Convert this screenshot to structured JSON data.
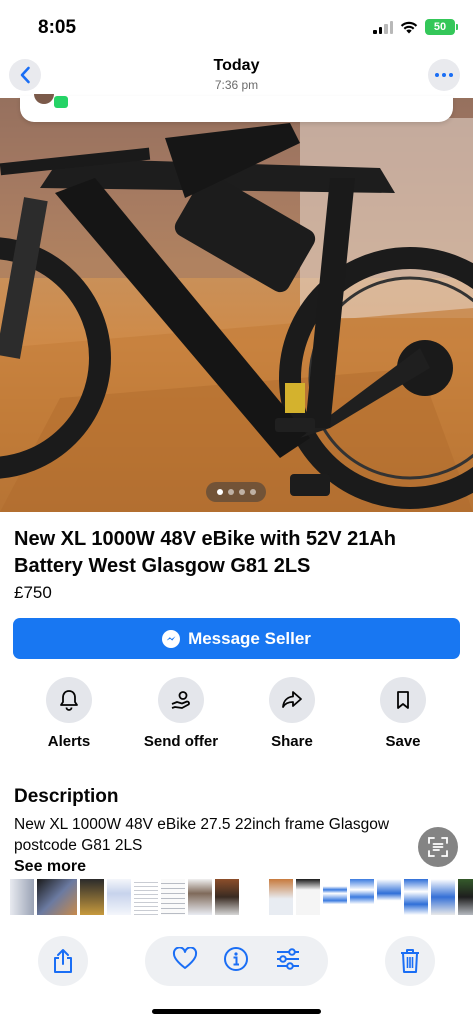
{
  "status_bar": {
    "time": "8:05",
    "battery": "50"
  },
  "photos_header": {
    "title": "Today",
    "subtitle": "7:36 pm"
  },
  "hero": {
    "page_count": 4,
    "active_page": 1
  },
  "listing": {
    "title": "New XL 1000W 48V eBike with 52V 21Ah Battery West Glasgow G81 2LS",
    "price": "£750",
    "message_button": "Message Seller"
  },
  "actions": [
    {
      "label": "Alerts",
      "icon": "bell-icon"
    },
    {
      "label": "Send offer",
      "icon": "offer-icon"
    },
    {
      "label": "Share",
      "icon": "share-icon"
    },
    {
      "label": "Save",
      "icon": "bookmark-icon"
    }
  ],
  "description": {
    "heading": "Description",
    "text": "New XL 1000W 48V eBike 27.5 22inch frame Glasgow postcode G81 2LS",
    "see_more": "See more"
  },
  "toolbar": {
    "icons": [
      "share-icon",
      "heart-icon",
      "info-icon",
      "adjust-icon",
      "trash-icon"
    ]
  },
  "colors": {
    "accent": "#1877f2",
    "ios_blue": "#1a6ef5",
    "battery_green": "#34c759"
  }
}
